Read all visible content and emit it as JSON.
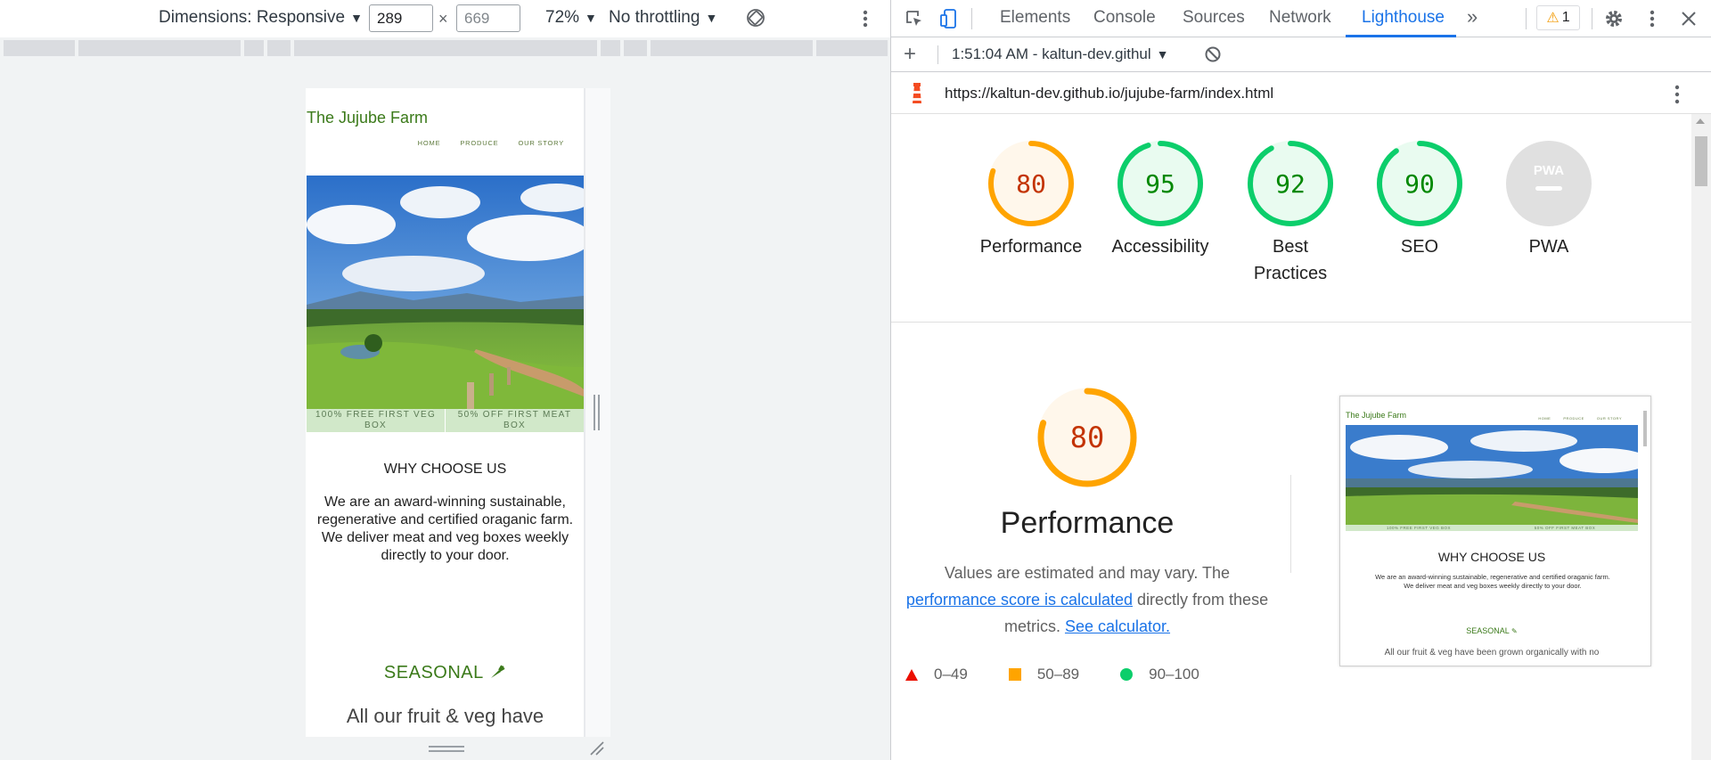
{
  "device_toolbar": {
    "dimensions_label": "Dimensions: Responsive",
    "width_value": "289",
    "height_placeholder": "669",
    "times": "×",
    "zoom": "72%",
    "throttling": "No throttling"
  },
  "site": {
    "title": "The Jujube Farm",
    "nav": [
      "HOME",
      "PRODUCE",
      "OUR STORY"
    ],
    "offers": [
      "100% FREE FIRST VEG BOX",
      "50% OFF FIRST MEAT BOX"
    ],
    "why_title": "WHY CHOOSE US",
    "why_text_1": "We are an award-winning sustainable, regenerative and certified oraganic farm.",
    "why_text_2": "We deliver meat and veg boxes weekly directly to your door.",
    "seasonal": "SEASONAL",
    "fruit_text": "All our fruit & veg have"
  },
  "devtools": {
    "tabs": [
      "Elements",
      "Console",
      "Sources",
      "Network",
      "Lighthouse"
    ],
    "active_tab": "Lighthouse",
    "more_tabs": "»",
    "warning_count": "1",
    "warning_icon": "⚠",
    "report_label": "1:51:04 AM - kaltun-dev.githul",
    "url": "https://kaltun-dev.github.io/jujube-farm/index.html"
  },
  "lighthouse": {
    "scores": [
      {
        "label": "Performance",
        "value": "80",
        "score": 80,
        "color": "#ffa400",
        "fill": "#fff7eb",
        "text": "#c33300"
      },
      {
        "label": "Accessibility",
        "value": "95",
        "score": 95,
        "color": "#0cce6b",
        "fill": "#e9fbf0",
        "text": "#008800"
      },
      {
        "label": "Best Practices",
        "value": "92",
        "score": 92,
        "color": "#0cce6b",
        "fill": "#e9fbf0",
        "text": "#008800"
      },
      {
        "label": "SEO",
        "value": "90",
        "score": 90,
        "color": "#0cce6b",
        "fill": "#e9fbf0",
        "text": "#008800"
      },
      {
        "label": "PWA",
        "value": "PWA",
        "score": 0,
        "color": "#e0e0e0",
        "fill": "#e0e0e0",
        "text": "#9e9e9e"
      }
    ],
    "performance": {
      "score": "80",
      "title": "Performance",
      "desc_1": "Values are estimated and may vary. The",
      "link_1": "performance score is calculated",
      "desc_2": "directly from these",
      "desc_3": "metrics.",
      "link_2": "See calculator."
    },
    "legend": [
      "0–49",
      "50–89",
      "90–100"
    ],
    "thumbnail": {
      "title": "The Jujube Farm",
      "nav": [
        "HOME",
        "PRODUCE",
        "OUR STORY"
      ],
      "offers": [
        "100% FREE FIRST VEG BOX",
        "50% OFF FIRST MEAT BOX"
      ],
      "why": "WHY CHOOSE US",
      "text_1": "We are an award-winning sustainable, regenerative and certified oraganic farm.",
      "text_2": "We deliver meat and veg boxes weekly directly to your door.",
      "seasonal": "SEASONAL",
      "fruit": "All our fruit & veg have been grown organically with no"
    }
  }
}
